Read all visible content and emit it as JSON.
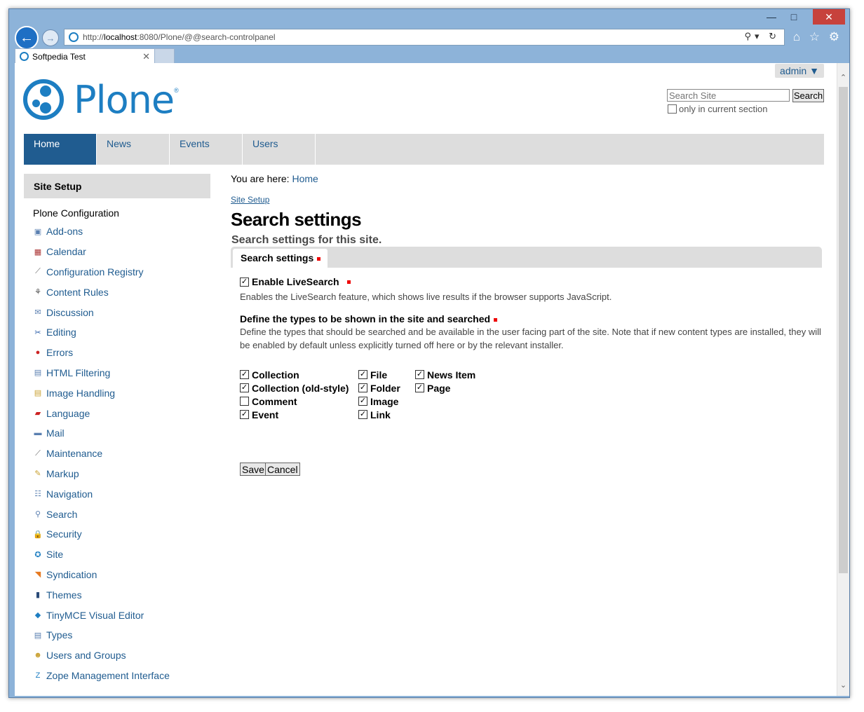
{
  "browser": {
    "url_prefix": "http://",
    "url_host": "localhost",
    "url_rest": ":8080/Plone/@@search-controlpanel",
    "tab_title": "Softpedia Test",
    "address_tools": "⚲▾ ↻",
    "toolbar_icons": "⌂ ☆ ⚙"
  },
  "header": {
    "admin_label": "admin ▼",
    "logo_text": "Plone",
    "logo_reg": "®",
    "search_placeholder": "Search Site",
    "search_button": "Search",
    "current_section_label": "only in current section"
  },
  "globalnav": [
    "Home",
    "News",
    "Events",
    "Users"
  ],
  "sidebar": {
    "title": "Site Setup",
    "subtitle": "Plone Configuration",
    "items": [
      {
        "label": "Add-ons",
        "icon": "puzzle-icon",
        "glyph": "▣",
        "color": "#5a7fb0"
      },
      {
        "label": "Calendar",
        "icon": "calendar-icon",
        "glyph": "▦",
        "color": "#a33"
      },
      {
        "label": "Configuration Registry",
        "icon": "wrench-icon",
        "glyph": "⟋",
        "color": "#666"
      },
      {
        "label": "Content Rules",
        "icon": "rules-icon",
        "glyph": "⚘",
        "color": "#555"
      },
      {
        "label": "Discussion",
        "icon": "discussion-icon",
        "glyph": "✉",
        "color": "#5a7fb0"
      },
      {
        "label": "Editing",
        "icon": "scissors-icon",
        "glyph": "✂",
        "color": "#2a5da8"
      },
      {
        "label": "Errors",
        "icon": "error-icon",
        "glyph": "●",
        "color": "#c22"
      },
      {
        "label": "HTML Filtering",
        "icon": "document-icon",
        "glyph": "▤",
        "color": "#5a7fb0"
      },
      {
        "label": "Image Handling",
        "icon": "image-icon",
        "glyph": "▤",
        "color": "#c9a030"
      },
      {
        "label": "Language",
        "icon": "flag-icon",
        "glyph": "▰",
        "color": "#c22"
      },
      {
        "label": "Mail",
        "icon": "mail-icon",
        "glyph": "▬",
        "color": "#5a7fb0"
      },
      {
        "label": "Maintenance",
        "icon": "wrench-icon",
        "glyph": "⟋",
        "color": "#666"
      },
      {
        "label": "Markup",
        "icon": "pencil-icon",
        "glyph": "✎",
        "color": "#c9a030"
      },
      {
        "label": "Navigation",
        "icon": "navigation-icon",
        "glyph": "☷",
        "color": "#5a7fb0"
      },
      {
        "label": "Search",
        "icon": "search-icon",
        "glyph": "⚲",
        "color": "#5a7fb0"
      },
      {
        "label": "Security",
        "icon": "lock-icon",
        "glyph": "🔒",
        "color": "#c9a030"
      },
      {
        "label": "Site",
        "icon": "plone-icon",
        "glyph": "✪",
        "color": "#1d7ec2"
      },
      {
        "label": "Syndication",
        "icon": "rss-icon",
        "glyph": "◥",
        "color": "#e67a22"
      },
      {
        "label": "Themes",
        "icon": "themes-icon",
        "glyph": "▮",
        "color": "#2a4a78"
      },
      {
        "label": "TinyMCE Visual Editor",
        "icon": "tinymce-icon",
        "glyph": "◆",
        "color": "#1d7ec2"
      },
      {
        "label": "Types",
        "icon": "document-icon",
        "glyph": "▤",
        "color": "#5a7fb0"
      },
      {
        "label": "Users and Groups",
        "icon": "users-icon",
        "glyph": "☻",
        "color": "#c9a030"
      },
      {
        "label": "Zope Management Interface",
        "icon": "zope-icon",
        "glyph": "Z",
        "color": "#1d7ec2"
      }
    ]
  },
  "main": {
    "breadcrumb_prefix": "You are here:",
    "breadcrumb_home": "Home",
    "site_setup_link": "Site Setup",
    "title": "Search settings",
    "description": "Search settings for this site.",
    "form_tab": "Search settings",
    "livesearch_label": "Enable LiveSearch",
    "livesearch_help": "Enables the LiveSearch feature, which shows live results if the browser supports JavaScript.",
    "types_label": "Define the types to be shown in the site and searched",
    "types_help": "Define the types that should be searched and be available in the user facing part of the site. Note that if new content types are installed, they will be enabled by default unless explicitly turned off here or by the relevant installer.",
    "types_columns": [
      [
        {
          "label": "Collection",
          "checked": true
        },
        {
          "label": "Collection (old-style)",
          "checked": true
        },
        {
          "label": "Comment",
          "checked": false
        },
        {
          "label": "Event",
          "checked": true
        }
      ],
      [
        {
          "label": "File",
          "checked": true
        },
        {
          "label": "Folder",
          "checked": true
        },
        {
          "label": "Image",
          "checked": true
        },
        {
          "label": "Link",
          "checked": true
        }
      ],
      [
        {
          "label": "News Item",
          "checked": true
        },
        {
          "label": "Page",
          "checked": true
        }
      ]
    ],
    "save_label": "Save",
    "cancel_label": "Cancel"
  }
}
